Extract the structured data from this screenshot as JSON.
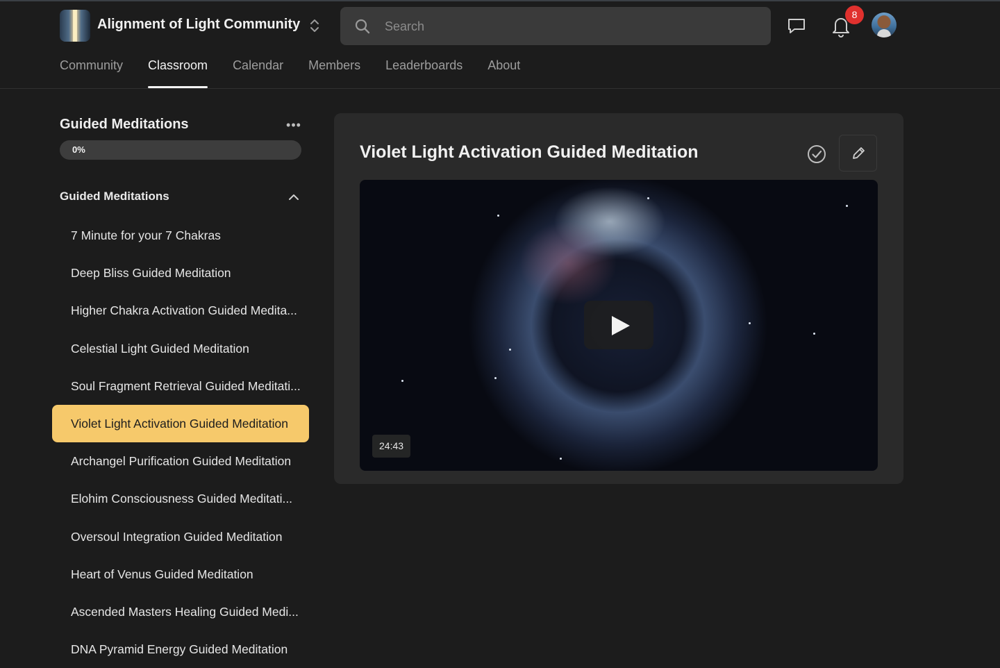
{
  "header": {
    "community_name": "Alignment of Light Community",
    "search": {
      "placeholder": "Search",
      "value": ""
    },
    "notifications_count": "8",
    "tabs": [
      {
        "label": "Community",
        "active": false
      },
      {
        "label": "Classroom",
        "active": true
      },
      {
        "label": "Calendar",
        "active": false
      },
      {
        "label": "Members",
        "active": false
      },
      {
        "label": "Leaderboards",
        "active": false
      },
      {
        "label": "About",
        "active": false
      }
    ]
  },
  "sidebar": {
    "course_title": "Guided Meditations",
    "progress": {
      "label": "0%",
      "value": 0
    },
    "section_title": "Guided Meditations",
    "lessons": [
      {
        "label": "7 Minute for your 7 Chakras",
        "active": false
      },
      {
        "label": "Deep Bliss Guided Meditation",
        "active": false
      },
      {
        "label": "Higher Chakra Activation Guided Medita...",
        "active": false
      },
      {
        "label": "Celestial Light Guided Meditation",
        "active": false
      },
      {
        "label": "Soul Fragment Retrieval Guided Meditati...",
        "active": false
      },
      {
        "label": "Violet Light Activation Guided Meditation",
        "active": true
      },
      {
        "label": "Archangel Purification Guided Meditation",
        "active": false
      },
      {
        "label": "Elohim Consciousness Guided Meditati...",
        "active": false
      },
      {
        "label": "Oversoul Integration Guided Meditation",
        "active": false
      },
      {
        "label": "Heart of Venus Guided Meditation",
        "active": false
      },
      {
        "label": "Ascended Masters Healing Guided Medi...",
        "active": false
      },
      {
        "label": "DNA Pyramid Energy Guided Meditation",
        "active": false
      }
    ]
  },
  "main": {
    "lesson_title": "Violet Light Activation Guided Meditation",
    "video": {
      "duration": "24:43"
    }
  },
  "colors": {
    "background": "#1c1c1c",
    "card": "#2a2a2a",
    "accent": "#f6c96b",
    "badge": "#e0312e"
  }
}
